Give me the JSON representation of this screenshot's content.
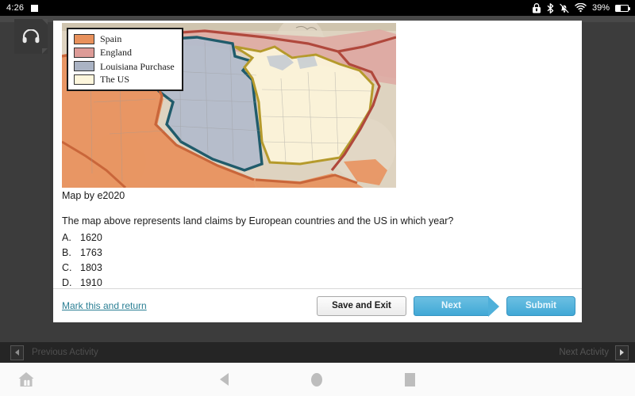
{
  "status_bar": {
    "time": "4:26",
    "notification_icon": "square-notification-icon",
    "icons": [
      "lock-icon",
      "bluetooth-icon",
      "vibrate-off-icon",
      "wifi-icon"
    ],
    "battery_percent": "39%",
    "battery_level": 39
  },
  "toolbar": {
    "headphone_icon": "headphone-icon"
  },
  "lesson": {
    "map_caption": "Map by e2020",
    "legend": [
      {
        "label": "Spain",
        "color": "#e8915c"
      },
      {
        "label": "England",
        "color": "#dd9b97"
      },
      {
        "label": "Louisiana Purchase",
        "color": "#aab3c4"
      },
      {
        "label": "The US",
        "color": "#fdf6dc"
      }
    ],
    "question": "The map above represents land claims by European countries and the US in which year?",
    "choices": [
      {
        "letter": "A.",
        "text": "1620"
      },
      {
        "letter": "B.",
        "text": "1763"
      },
      {
        "letter": "C.",
        "text": "1803"
      },
      {
        "letter": "D.",
        "text": "1910"
      }
    ]
  },
  "footer": {
    "mark_link": "Mark this and return",
    "save_label": "Save and Exit",
    "next_label": "Next",
    "submit_label": "Submit"
  },
  "activity_nav": {
    "previous_label": "Previous Activity",
    "next_label": "Next Activity",
    "prev_icon": "triangle-left-icon",
    "next_icon": "triangle-right-icon"
  },
  "system_nav": {
    "home_app_icon": "house-icon",
    "back_icon": "back-triangle-icon",
    "home_icon": "home-circle-icon",
    "recents_icon": "recents-square-icon"
  }
}
